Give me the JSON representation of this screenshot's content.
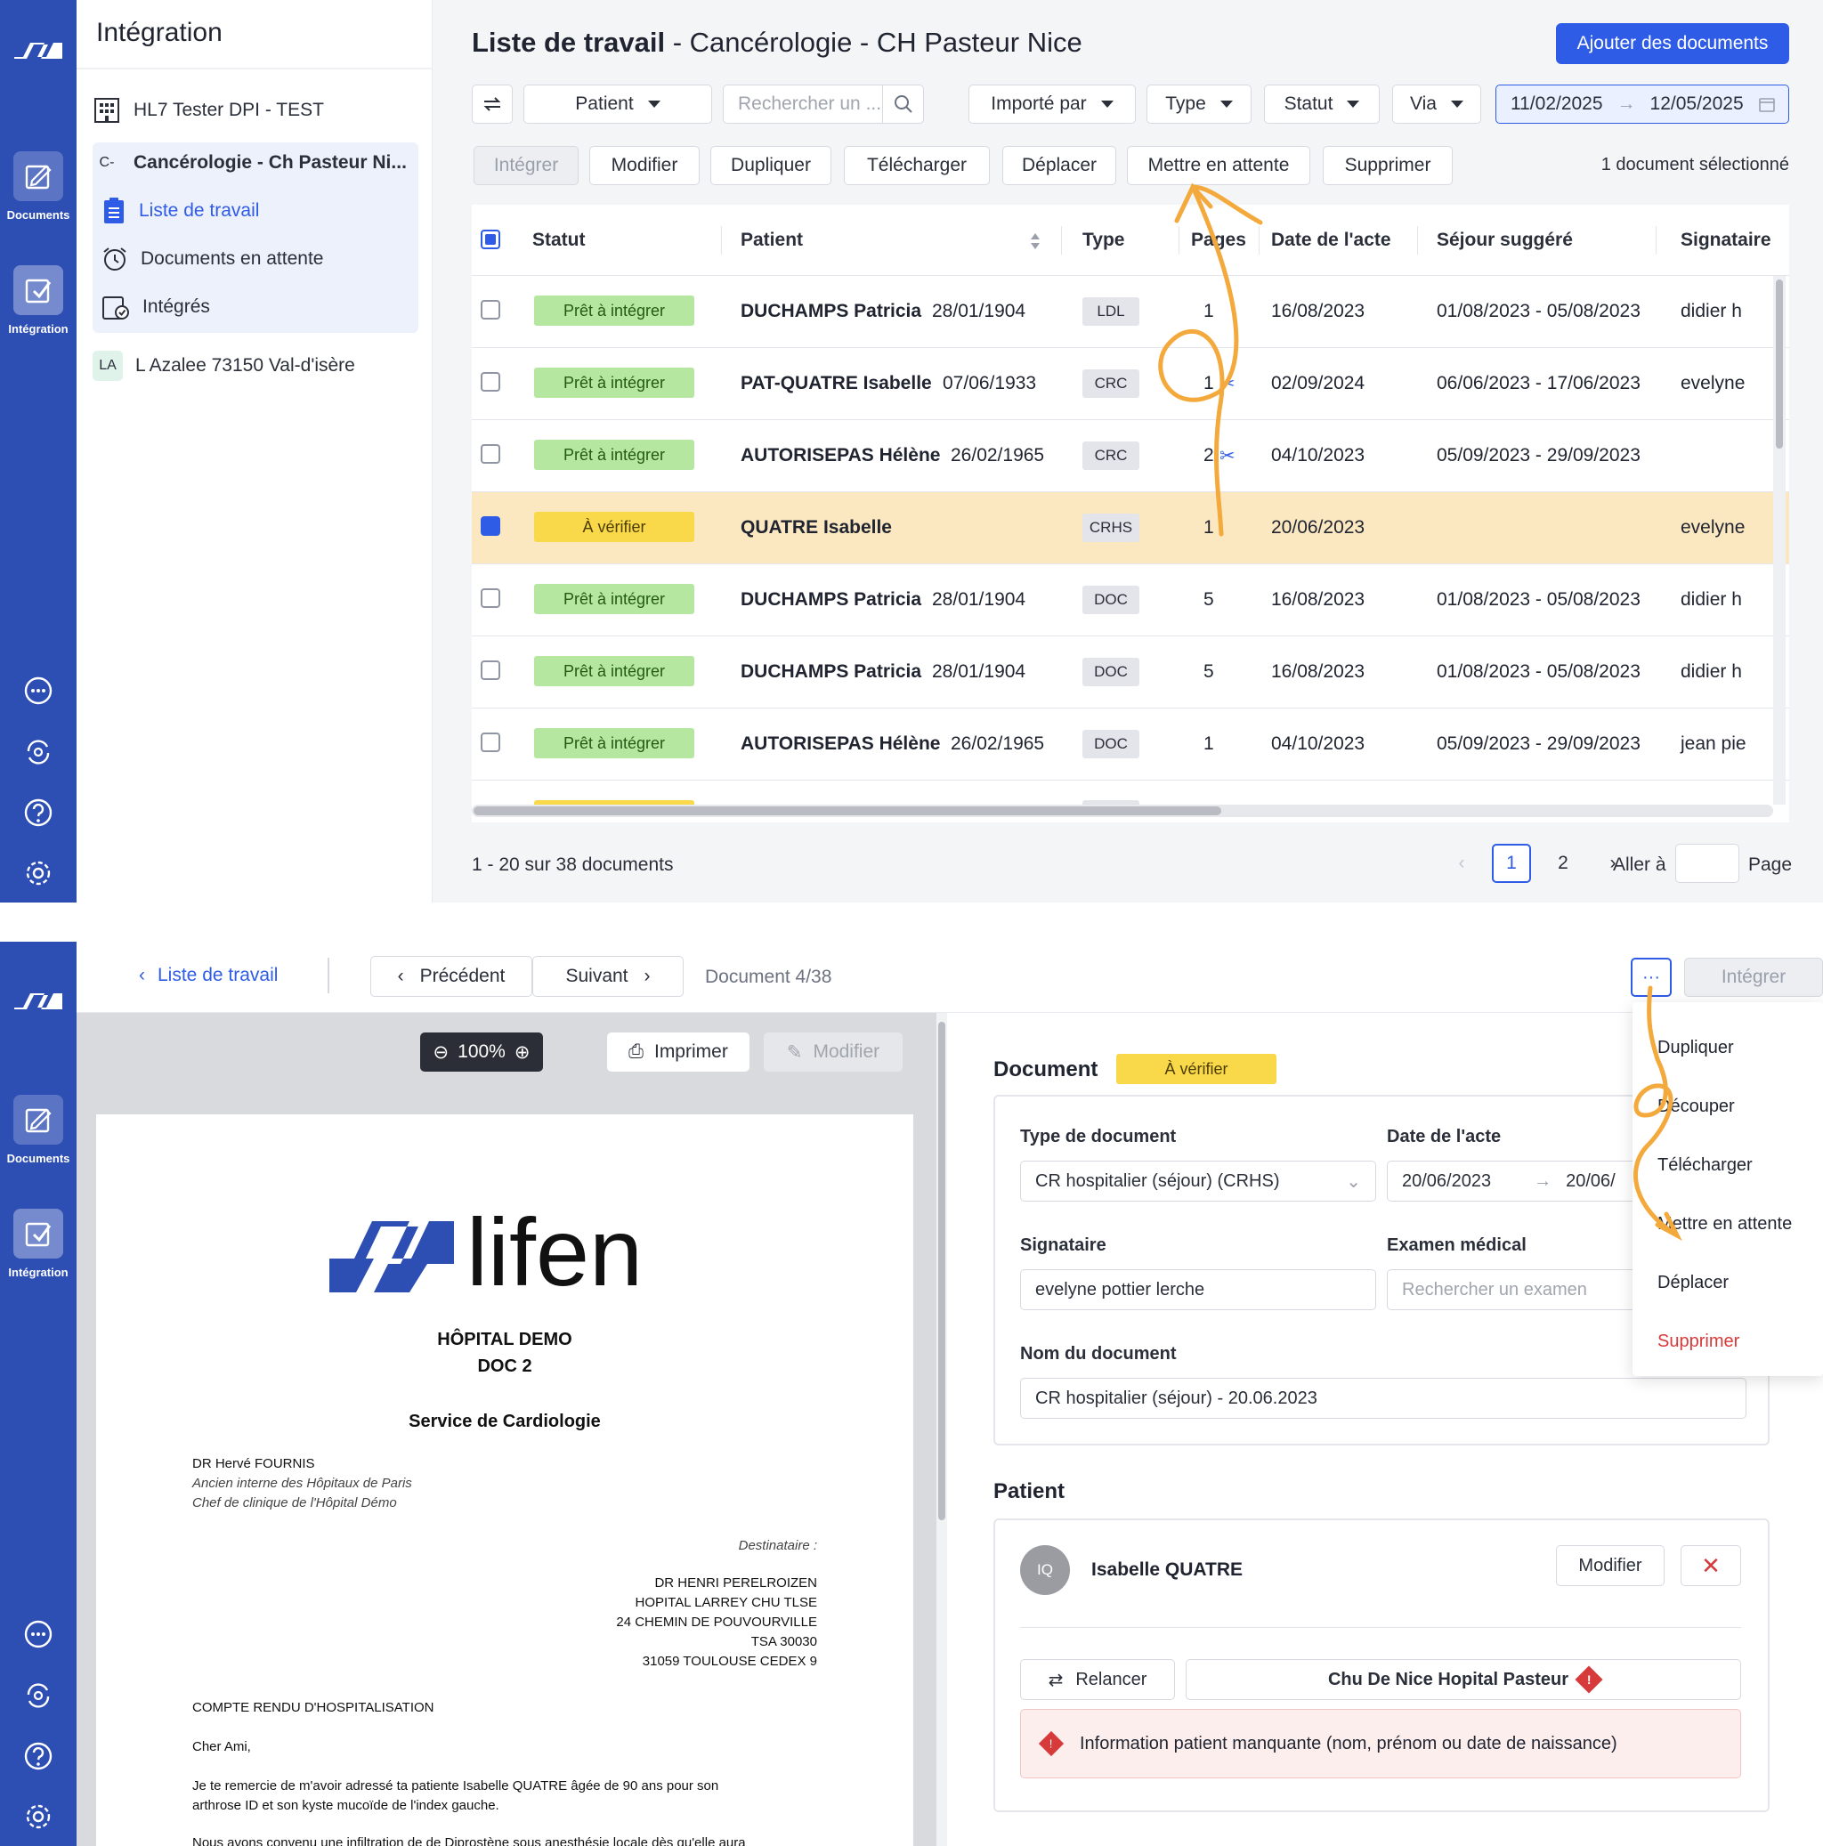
{
  "rail": {
    "nav1_label": "Documents",
    "nav2_label": "Intégration"
  },
  "sidebar": {
    "title": "Intégration",
    "items": [
      {
        "label": "HL7 Tester DPI - TEST"
      },
      {
        "label": "Cancérologie - Ch Pasteur Ni...",
        "prefix": "C-"
      },
      {
        "label": "Liste de travail"
      },
      {
        "label": "Documents en attente"
      },
      {
        "label": "Intégrés"
      },
      {
        "label": "L Azalee 73150 Val-d'isère",
        "prefix": "LA"
      }
    ]
  },
  "main": {
    "title_bold": "Liste de travail",
    "title_rest": " - Cancérologie - CH Pasteur Nice",
    "add_button": "Ajouter des documents",
    "filters": {
      "patient": "Patient",
      "search_placeholder": "Rechercher un ...",
      "imported_by": "Importé par",
      "type": "Type",
      "status": "Statut",
      "via": "Via",
      "date_from": "11/02/2025",
      "date_to": "12/05/2025"
    },
    "actions": [
      "Intégrer",
      "Modifier",
      "Dupliquer",
      "Télécharger",
      "Déplacer",
      "Mettre en attente",
      "Supprimer"
    ],
    "selection_info": "1 document sélectionné",
    "columns": [
      "Statut",
      "Patient",
      "Type",
      "Pages",
      "Date de l'acte",
      "Séjour suggéré",
      "Signataire"
    ],
    "rows": [
      {
        "status": "Prêt à intégrer",
        "patient": "DUCHAMPS Patricia",
        "dob": "28/01/1904",
        "type": "LDL",
        "pages": "1",
        "date": "16/08/2023",
        "sejour": "01/08/2023 - 05/08/2023",
        "signataire": "didier h"
      },
      {
        "status": "Prêt à intégrer",
        "patient": "PAT-QUATRE Isabelle",
        "dob": "07/06/1933",
        "type": "CRC",
        "pages": "1",
        "date": "02/09/2024",
        "sejour": "06/06/2023 - 17/06/2023",
        "signataire": "evelyne"
      },
      {
        "status": "Prêt à intégrer",
        "patient": "AUTORISEPAS Hélène",
        "dob": "26/02/1965",
        "type": "CRC",
        "pages": "2",
        "date": "04/10/2023",
        "sejour": "05/09/2023 - 29/09/2023",
        "signataire": ""
      },
      {
        "status": "À vérifier",
        "patient": "QUATRE Isabelle",
        "dob": "",
        "type": "CRHS",
        "pages": "1",
        "date": "20/06/2023",
        "sejour": "",
        "signataire": "evelyne"
      },
      {
        "status": "Prêt à intégrer",
        "patient": "DUCHAMPS Patricia",
        "dob": "28/01/1904",
        "type": "DOC",
        "pages": "5",
        "date": "16/08/2023",
        "sejour": "01/08/2023 - 05/08/2023",
        "signataire": "didier h"
      },
      {
        "status": "Prêt à intégrer",
        "patient": "DUCHAMPS Patricia",
        "dob": "28/01/1904",
        "type": "DOC",
        "pages": "5",
        "date": "16/08/2023",
        "sejour": "01/08/2023 - 05/08/2023",
        "signataire": "didier h"
      },
      {
        "status": "Prêt à intégrer",
        "patient": "AUTORISEPAS Hélène",
        "dob": "26/02/1965",
        "type": "DOC",
        "pages": "1",
        "date": "04/10/2023",
        "sejour": "05/09/2023 - 29/09/2023",
        "signataire": "jean pie"
      }
    ],
    "pager": {
      "info": "1 - 20 sur 38 documents",
      "pages": [
        "1",
        "2"
      ],
      "goto_label": "Aller à",
      "page_label": "Page"
    }
  },
  "detail": {
    "back_label": "Liste de travail",
    "prev_label": "Précédent",
    "next_label": "Suivant",
    "doc_counter": "Document 4/38",
    "more_label": "···",
    "integrate_label": "Intégrer",
    "viewer": {
      "zoom": "100%",
      "print": "Imprimer",
      "edit": "Modifier"
    },
    "letter": {
      "brand": "lifen",
      "hospital": "HÔPITAL DEMO",
      "doc": "DOC 2",
      "service": "Service de Cardiologie",
      "doctor": "DR Hervé FOURNIS",
      "doctor_l1": "Ancien interne des Hôpitaux de Paris",
      "doctor_l2": "Chef de clinique de l'Hôpital Démo",
      "dest_label": "Destinataire :",
      "dest": [
        "DR HENRI PERELROIZEN",
        "HOPITAL LARREY CHU TLSE",
        "24 CHEMIN DE POUVOURVILLE",
        "TSA 30030",
        "31059 TOULOUSE CEDEX 9"
      ],
      "subject": "COMPTE RENDU D'HOSPITALISATION",
      "greeting": "Cher Ami,",
      "body1": "Je te remercie de m'avoir adressé ta patiente Isabelle QUATRE âgée de 90 ans pour son",
      "body2": "arthrose ID et son kyste mucoïde de l'index gauche.",
      "body3": "Nous avons convenu une infiltration de de Diprostène sous anesthésie locale dès qu'elle aura"
    },
    "document": {
      "section_title": "Document",
      "status": "À vérifier",
      "type_label": "Type de document",
      "type_value": "CR hospitalier (séjour) (CRHS)",
      "date_label": "Date de l'acte",
      "date_from": "20/06/2023",
      "date_to": "20/06/",
      "signer_label": "Signataire",
      "signer_value": "evelyne pottier lerche",
      "exam_label": "Examen médical",
      "exam_placeholder": "Rechercher un examen",
      "name_label": "Nom du document",
      "name_value": "CR hospitalier (séjour) - 20.06.2023"
    },
    "patient": {
      "section_title": "Patient",
      "initials": "IQ",
      "name": "Isabelle QUATRE",
      "edit_label": "Modifier",
      "relaunch_label": "Relancer",
      "hospital": "Chu De Nice Hopital Pasteur",
      "alert": "Information patient manquante (nom, prénom ou date de naissance)"
    },
    "menu": [
      "Dupliquer",
      "Découper",
      "Télécharger",
      "Mettre en attente",
      "Déplacer",
      "Supprimer"
    ]
  },
  "colors": {
    "brand_blue": "#2d4eb3",
    "primary": "#2f5ce6",
    "ready_green": "#b6e7a0",
    "verify_yellow": "#f9d94a",
    "danger": "#d63a3a",
    "annotation_orange": "#f3a93b"
  }
}
